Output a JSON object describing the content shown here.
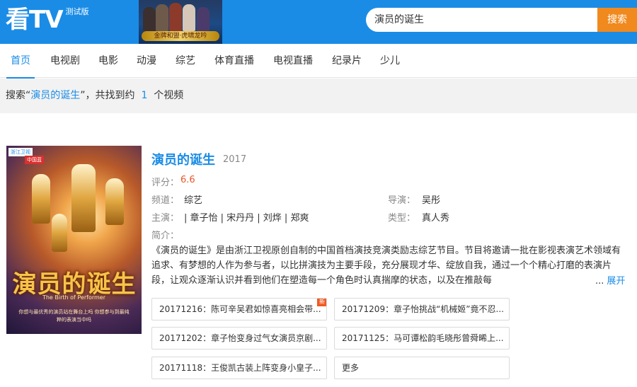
{
  "header": {
    "logo_text": "看TV",
    "logo_badge": "测试版",
    "banner_caption": "金牌和盟·虎啸龙吟",
    "search_value": "演员的诞生",
    "search_button": "搜索"
  },
  "nav": {
    "items": [
      "首页",
      "电视剧",
      "电影",
      "动漫",
      "综艺",
      "体育直播",
      "电视直播",
      "纪录片",
      "少儿"
    ],
    "active_index": 0
  },
  "result": {
    "prefix": "搜索“",
    "keyword": "演员的诞生",
    "middle": "”，共找到约",
    "count": "1",
    "suffix": "个视频"
  },
  "poster": {
    "tag": "浙江卫视",
    "tag2": "中国蓝",
    "title": "演员的诞生",
    "english": "The Birth of Performer",
    "subtitle": "你想与最优秀的演员站在舞台上吗 你想参与到最纯粹的表演当中吗"
  },
  "show": {
    "title": "演员的诞生",
    "year": "2017",
    "score_label": "评分：",
    "score": "6.6",
    "channel_label": "频道：",
    "channel": "综艺",
    "director_label": "导演：",
    "director": "吴彤",
    "cast_label": "主演：",
    "cast": "| 章子怡 | 宋丹丹 | 刘烨 | 郑爽",
    "genre_label": "类型：",
    "genre": "真人秀",
    "intro_label": "简介：",
    "intro": "《演员的诞生》是由浙江卫视原创自制的中国首档演技竞演类励志综艺节目。节目将邀请一批在影视表演艺术领域有追求、有梦想的人作为参与者，以比拼演技为主要手段，充分展现才华、绽放自我，通过一个个精心打磨的表演片段，让观众逐渐认识并看到他们在塑造每一个角色时认真揣摩的状态，以及在推敲每",
    "expand_dots": "...",
    "expand": "展开"
  },
  "episodes": [
    {
      "label": "20171216：陈可辛吴君如惊喜亮相会带...",
      "new": "新"
    },
    {
      "label": "20171209：章子怡挑战“机械姬”竟不忍..."
    },
    {
      "label": "20171202：章子怡变身过气女演员京剧..."
    },
    {
      "label": "20171125：马可谭松韵毛晓彤曾舜晞上..."
    },
    {
      "label": "20171118：王俊凯古装上阵变身小皇子..."
    },
    {
      "label": "更多"
    }
  ],
  "colors": {
    "header_bg": "#1a8ce6",
    "accent": "#1a8ce6",
    "search_button": "#f08a1e",
    "score": "#e8562a",
    "new_badge": "#f05a24"
  }
}
